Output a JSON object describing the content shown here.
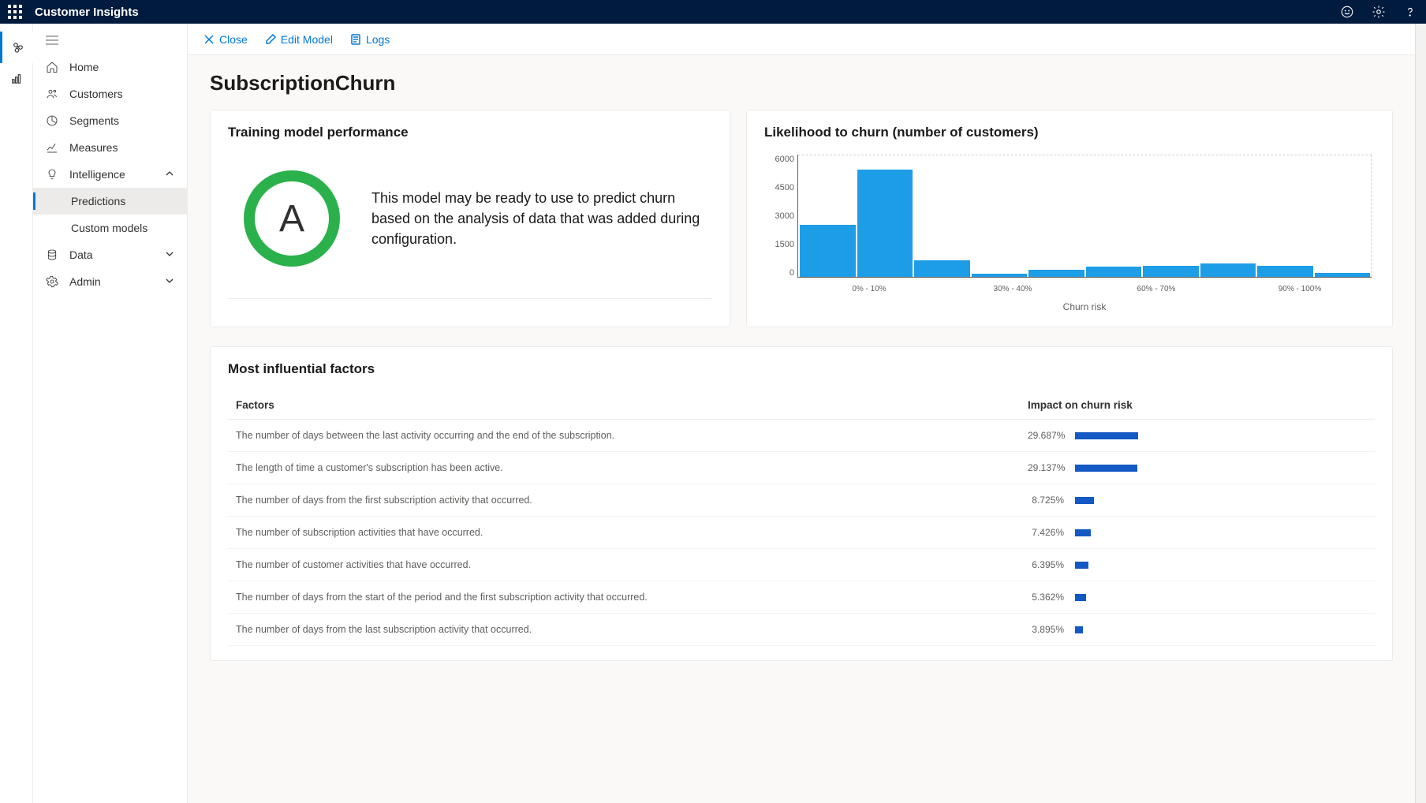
{
  "app_name": "Customer Insights",
  "commands": {
    "close": "Close",
    "edit": "Edit Model",
    "logs": "Logs"
  },
  "nav": {
    "home": "Home",
    "customers": "Customers",
    "segments": "Segments",
    "measures": "Measures",
    "intelligence": "Intelligence",
    "predictions": "Predictions",
    "custom_models": "Custom models",
    "data": "Data",
    "admin": "Admin"
  },
  "page_title": "SubscriptionChurn",
  "perf": {
    "title": "Training model performance",
    "grade": "A",
    "text": "This model may be ready to use to predict churn based on the analysis of data that was added during configuration."
  },
  "churn": {
    "title": "Likelihood to churn (number of customers)",
    "ylabel": "",
    "xlabel": "Churn risk"
  },
  "chart_data": {
    "type": "bar",
    "title": "Likelihood to churn (number of customers)",
    "xlabel": "Churn risk",
    "ylabel": "Number of customers",
    "ylim": [
      0,
      6000
    ],
    "yticks": [
      0,
      1500,
      3000,
      4500,
      6000
    ],
    "categories": [
      "0% - 10%",
      "10% - 20%",
      "20% - 30%",
      "30% - 40%",
      "40% - 50%",
      "50% - 60%",
      "60% - 70%",
      "70% - 80%",
      "80% - 90%",
      "90% - 100%"
    ],
    "x_tick_labels": [
      "0% - 10%",
      "30% - 40%",
      "60% - 70%",
      "90% - 100%"
    ],
    "values": [
      2550,
      5250,
      800,
      150,
      350,
      500,
      550,
      650,
      550,
      200
    ]
  },
  "factors": {
    "title": "Most influential factors",
    "col_factor": "Factors",
    "col_impact": "Impact on churn risk",
    "rows": [
      {
        "text": "The number of days between the last activity occurring and the end of the subscription.",
        "pct": "29.687%",
        "val": 29.687
      },
      {
        "text": "The length of time a customer's subscription has been active.",
        "pct": "29.137%",
        "val": 29.137
      },
      {
        "text": "The number of days from the first subscription activity that occurred.",
        "pct": "8.725%",
        "val": 8.725
      },
      {
        "text": "The number of subscription activities that have occurred.",
        "pct": "7.426%",
        "val": 7.426
      },
      {
        "text": "The number of customer activities that have occurred.",
        "pct": "6.395%",
        "val": 6.395
      },
      {
        "text": "The number of days from the start of the period and the first subscription activity that occurred.",
        "pct": "5.362%",
        "val": 5.362
      },
      {
        "text": "The number of days from the last subscription activity that occurred.",
        "pct": "3.895%",
        "val": 3.895
      }
    ]
  }
}
